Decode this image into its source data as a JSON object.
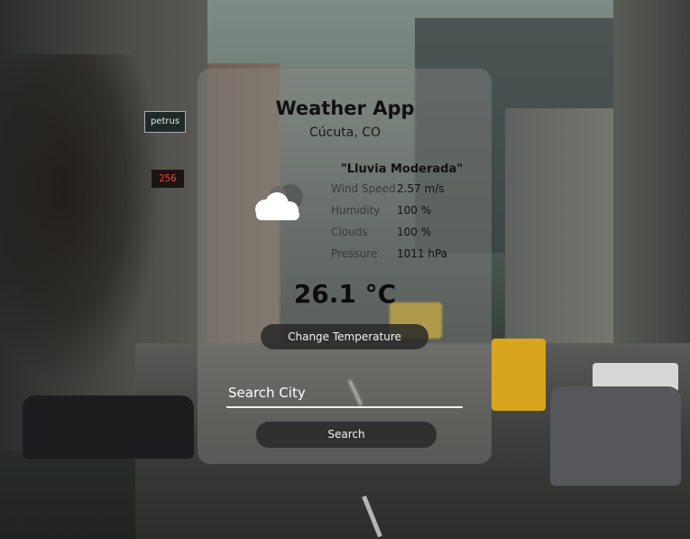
{
  "app": {
    "title": "Weather App",
    "city": "Cúcuta, CO"
  },
  "background": {
    "store_sign": "petrus",
    "street_temp_display": "256"
  },
  "weather": {
    "description": "\"Lluvia Moderada\"",
    "icon": "cloud-icon",
    "temperature": "26.1 °C",
    "stats": [
      {
        "label": "Wind Speed",
        "value": "2.57 m/s"
      },
      {
        "label": "Humidity",
        "value": "100 %"
      },
      {
        "label": "Clouds",
        "value": "100 %"
      },
      {
        "label": "Pressure",
        "value": "1011 hPa"
      }
    ]
  },
  "controls": {
    "change_temp_label": "Change Temperature",
    "search_placeholder": "Search City",
    "search_value": "",
    "search_button_label": "Search"
  }
}
